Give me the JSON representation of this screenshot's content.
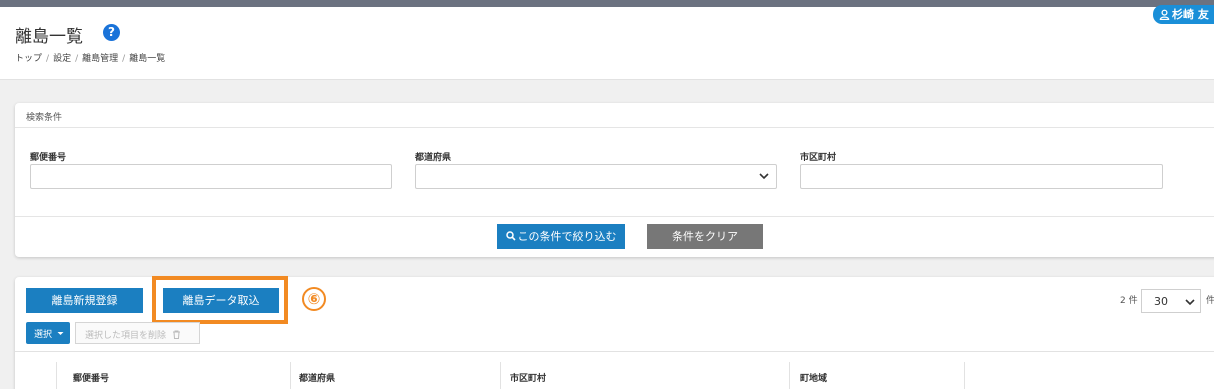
{
  "header": {
    "title": "離島一覧",
    "help_symbol": "?",
    "breadcrumb": [
      "トップ",
      "設定",
      "離島管理",
      "離島一覧"
    ],
    "user_name": "杉崎 友"
  },
  "search": {
    "panel_title": "検索条件",
    "fields": [
      {
        "label": "郵便番号",
        "value": ""
      },
      {
        "label": "都道府県",
        "value": ""
      },
      {
        "label": "市区町村",
        "value": ""
      }
    ],
    "filter_button": "この条件で絞り込む",
    "clear_button": "条件をクリア"
  },
  "list": {
    "new_button": "離島新規登録",
    "import_button": "離島データ取込",
    "annotation": "⑥",
    "count_prefix": "2 件",
    "per_page": "30",
    "count_suffix": "件",
    "select_button": "選択",
    "delete_button": "選択した項目を削除",
    "columns": [
      "郵便番号",
      "都道府県",
      "市区町村",
      "町地域"
    ]
  },
  "colors": {
    "primary": "#1b7fc1",
    "highlight": "#f28a22",
    "topbar": "#6b7280"
  }
}
